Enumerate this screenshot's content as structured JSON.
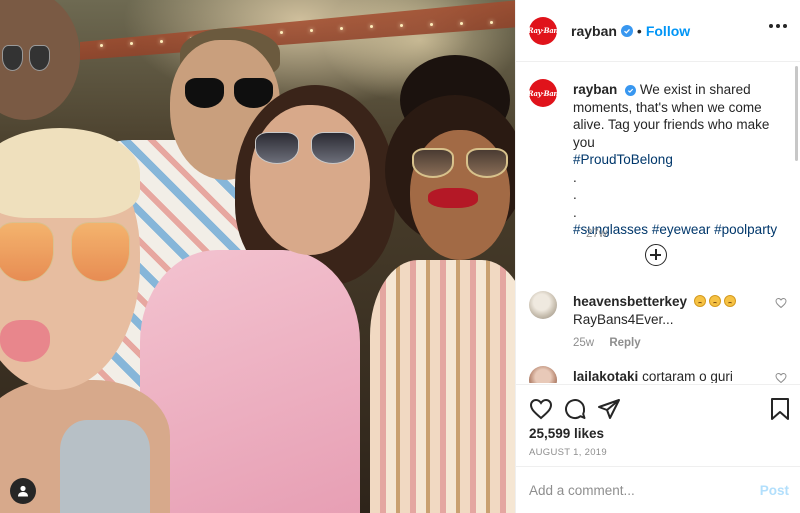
{
  "photo": {
    "description_icon": "user-tag-icon"
  },
  "header": {
    "logo_text": "Ray·Ban",
    "username": "rayban",
    "verified_icon": "verified-badge-icon",
    "separator": "•",
    "follow_label": "Follow",
    "more_icon": "more-options-icon"
  },
  "caption": {
    "username": "rayban",
    "text_line1": "We exist in shared moments, that's when we come alive. Tag your friends who make you",
    "hashtag1": "#ProudToBelong",
    "dot1": ".",
    "dot2": ".",
    "dot3": ".",
    "hashtags": [
      "#sunglasses",
      "#eyewear",
      "#poolparty"
    ],
    "time": "27w"
  },
  "load_more_icon": "plus-circle-icon",
  "comments": [
    {
      "username": "heavensbetterkey",
      "text": "RayBans4Ever...",
      "time": "25w",
      "reply_label": "Reply"
    },
    {
      "username": "lailakotaki",
      "text": "cortaram o guri mais"
    }
  ],
  "actions": {
    "like_icon": "heart-icon",
    "comment_icon": "comment-icon",
    "share_icon": "share-icon",
    "save_icon": "bookmark-icon",
    "likes": "25,599 likes",
    "date": "August 1, 2019"
  },
  "add_comment": {
    "placeholder": "Add a comment...",
    "post_label": "Post"
  },
  "colors": {
    "brand_red": "#e0131b",
    "follow_blue": "#0095f6",
    "hashtag": "#00376b",
    "post_disabled": "#b2dffc"
  }
}
